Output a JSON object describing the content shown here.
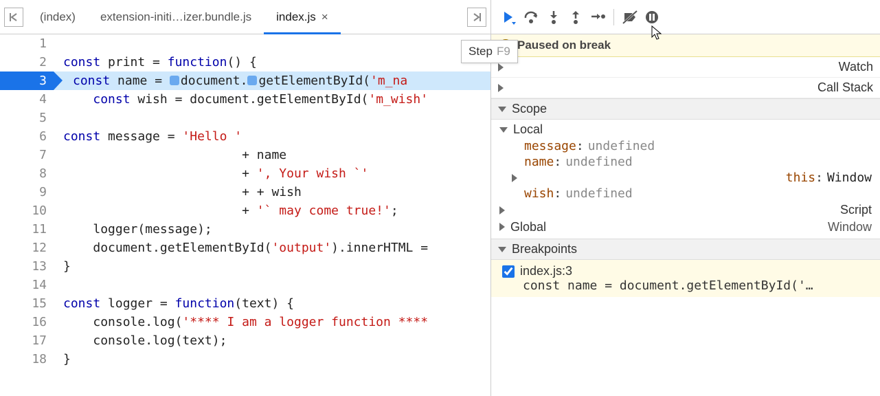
{
  "tabs": {
    "items": [
      "(index)",
      "extension-initi…izer.bundle.js",
      "index.js"
    ],
    "active_index": 2
  },
  "lineCount": 18,
  "highlightLine": 3,
  "code": [
    {
      "tokens": []
    },
    {
      "tokens": [
        [
          "kw",
          "const"
        ],
        [
          "op",
          " print "
        ],
        [
          "op",
          "= "
        ],
        [
          "kw",
          "function"
        ],
        [
          "op",
          "() {"
        ]
      ]
    },
    {
      "hl": true,
      "tokens": [
        [
          "kw",
          "const"
        ],
        [
          "op",
          " name "
        ],
        [
          "op",
          "= "
        ],
        [
          "dmark",
          ""
        ],
        [
          "op",
          "document."
        ],
        [
          "dmark",
          ""
        ],
        [
          "fn",
          "getElementById"
        ],
        [
          "op",
          "("
        ],
        [
          "str",
          "'m_na"
        ]
      ]
    },
    {
      "pad": "    ",
      "tokens": [
        [
          "kw",
          "const"
        ],
        [
          "op",
          " wish "
        ],
        [
          "op",
          "= "
        ],
        [
          "op",
          "document."
        ],
        [
          "fn",
          "getElementById"
        ],
        [
          "op",
          "("
        ],
        [
          "str",
          "'m_wish'"
        ]
      ]
    },
    {
      "tokens": []
    },
    {
      "tokens": [
        [
          "kw",
          "const"
        ],
        [
          "op",
          " message "
        ],
        [
          "op",
          "= "
        ],
        [
          "str",
          "'Hello '"
        ]
      ]
    },
    {
      "pad": "                        ",
      "tokens": [
        [
          "op",
          "+ "
        ],
        [
          "op",
          "name"
        ]
      ]
    },
    {
      "pad": "                        ",
      "tokens": [
        [
          "op",
          "+ "
        ],
        [
          "str",
          "', Your wish `'"
        ]
      ]
    },
    {
      "pad": "                        ",
      "tokens": [
        [
          "op",
          "+ + "
        ],
        [
          "op",
          "wish"
        ]
      ]
    },
    {
      "pad": "                        ",
      "tokens": [
        [
          "op",
          "+ "
        ],
        [
          "str",
          "'` may come true!'"
        ],
        [
          "op",
          ";"
        ]
      ]
    },
    {
      "pad": "    ",
      "tokens": [
        [
          "fn",
          "logger"
        ],
        [
          "op",
          "(message);"
        ]
      ]
    },
    {
      "pad": "    ",
      "tokens": [
        [
          "op",
          "document."
        ],
        [
          "fn",
          "getElementById"
        ],
        [
          "op",
          "("
        ],
        [
          "str",
          "'output'"
        ],
        [
          "op",
          ").innerHTML = "
        ]
      ]
    },
    {
      "tokens": [
        [
          "op",
          "}"
        ]
      ]
    },
    {
      "tokens": []
    },
    {
      "tokens": [
        [
          "kw",
          "const"
        ],
        [
          "op",
          " logger "
        ],
        [
          "op",
          "= "
        ],
        [
          "kw",
          "function"
        ],
        [
          "op",
          "(text) {"
        ]
      ]
    },
    {
      "pad": "    ",
      "tokens": [
        [
          "op",
          "console."
        ],
        [
          "fn",
          "log"
        ],
        [
          "op",
          "("
        ],
        [
          "str",
          "'**** I am a logger function ****"
        ]
      ]
    },
    {
      "pad": "    ",
      "tokens": [
        [
          "op",
          "console."
        ],
        [
          "fn",
          "log"
        ],
        [
          "op",
          "(text);"
        ]
      ]
    },
    {
      "tokens": [
        [
          "op",
          "}"
        ]
      ]
    }
  ],
  "tooltip": {
    "label": "Step",
    "shortcut": "F9"
  },
  "banner": "Paused on break",
  "panes": {
    "watch": "Watch",
    "callstack": "Call Stack",
    "scope": "Scope",
    "local": "Local",
    "vars": [
      {
        "name": "message",
        "value": "undefined",
        "type": "undef"
      },
      {
        "name": "name",
        "value": "undefined",
        "type": "undef"
      },
      {
        "name": "this",
        "value": "Window",
        "type": "obj",
        "expandable": true
      },
      {
        "name": "wish",
        "value": "undefined",
        "type": "undef"
      }
    ],
    "script": "Script",
    "global": {
      "label": "Global",
      "value": "Window"
    },
    "breakpoints_label": "Breakpoints",
    "bp": {
      "file": "index.js:3",
      "code": "const name = document.getElementById('…"
    }
  },
  "icons": {
    "resume": "resume",
    "stepover": "step-over",
    "stepinto": "step-into",
    "stepout": "step-out",
    "step": "step",
    "deactivate": "deactivate-breakpoints",
    "pause": "pause-on-exceptions"
  }
}
